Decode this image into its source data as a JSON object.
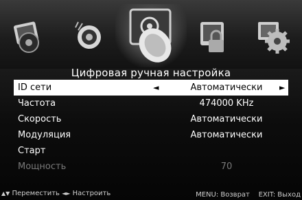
{
  "menu": {
    "title": "Цифровая ручная настройка",
    "icons": [
      {
        "name": "picture-icon"
      },
      {
        "name": "sound-icon"
      },
      {
        "name": "channel-icon"
      },
      {
        "name": "lock-icon"
      },
      {
        "name": "settings-icon"
      }
    ],
    "rows": [
      {
        "label": "ID сети",
        "value": "Автоматически",
        "left_arrow": "◄",
        "right_arrow": "►"
      },
      {
        "label": "Частота",
        "value": "474000 KHz"
      },
      {
        "label": "Скорость",
        "value": "Автоматически"
      },
      {
        "label": "Модуляция",
        "value": "Автоматически"
      },
      {
        "label": "Старт",
        "value": ""
      },
      {
        "label": "Мощность",
        "value": "70"
      }
    ]
  },
  "footer": {
    "move_label": "Переместить",
    "adjust_label": "Настроить",
    "menu_hint": "MENU: Возврат",
    "exit_hint": "EXIT: Выход"
  },
  "colors": {
    "selected_row_bg": "#ffffff",
    "disabled_text": "#7a7a7a"
  }
}
